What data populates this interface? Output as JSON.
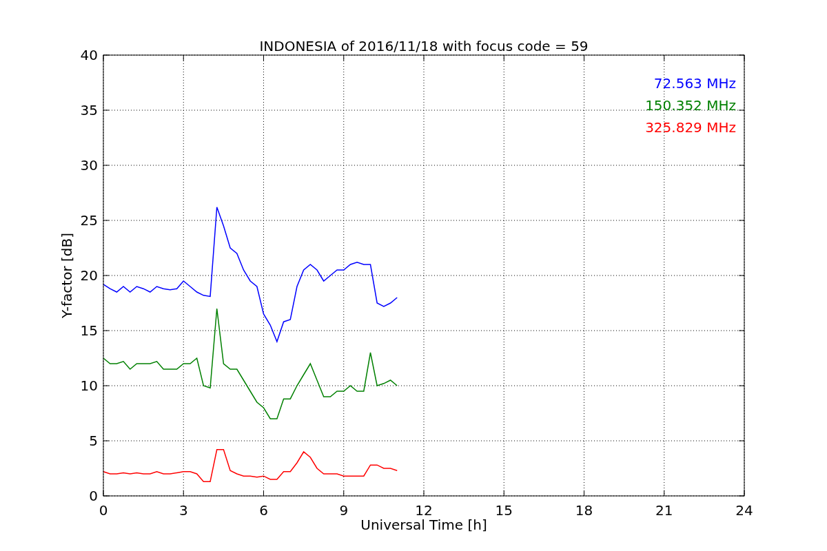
{
  "figure": {
    "chart_data": {
      "type": "line",
      "title": "INDONESIA of 2016/11/18 with focus code = 59",
      "xlabel": "Universal Time [h]",
      "ylabel": "Y-factor [dB]",
      "x": [
        0,
        0.25,
        0.5,
        0.75,
        1,
        1.25,
        1.5,
        1.75,
        2,
        2.25,
        2.5,
        2.75,
        3,
        3.25,
        3.5,
        3.75,
        4,
        4.25,
        4.5,
        4.75,
        5,
        5.25,
        5.5,
        5.75,
        6,
        6.25,
        6.5,
        6.75,
        7,
        7.25,
        7.5,
        7.75,
        8,
        8.25,
        8.5,
        8.75,
        9,
        9.25,
        9.5,
        9.75,
        10,
        10.25,
        10.5,
        10.75,
        11
      ],
      "series": [
        {
          "name": "72.563 MHz",
          "color": "#0000ff",
          "values": [
            19.2,
            18.8,
            18.5,
            19,
            18.5,
            19,
            18.8,
            18.5,
            19,
            18.8,
            18.7,
            18.8,
            19.5,
            19,
            18.5,
            18.2,
            18.1,
            26.2,
            24.5,
            22.5,
            22,
            20.5,
            19.5,
            19,
            16.5,
            15.5,
            14,
            15.8,
            16,
            19,
            20.5,
            21,
            20.5,
            19.5,
            20,
            20.5,
            20.5,
            21,
            21.2,
            21,
            21,
            17.5,
            17.2,
            17.5,
            18
          ]
        },
        {
          "name": "150.352 MHz",
          "color": "#008000",
          "values": [
            12.5,
            12,
            12,
            12.2,
            11.5,
            12,
            12,
            12,
            12.2,
            11.5,
            11.5,
            11.5,
            12,
            12,
            12.5,
            10,
            9.8,
            17,
            12,
            11.5,
            11.5,
            10.5,
            9.5,
            8.5,
            8,
            7,
            7,
            8.8,
            8.8,
            10,
            11,
            12,
            10.5,
            9,
            9,
            9.5,
            9.5,
            10,
            9.5,
            9.5,
            13,
            10,
            10.2,
            10.5,
            10
          ]
        },
        {
          "name": "325.829 MHz",
          "color": "#ff0000",
          "values": [
            2.2,
            2,
            2,
            2.1,
            2,
            2.1,
            2,
            2,
            2.2,
            2,
            2,
            2.1,
            2.2,
            2.2,
            2,
            1.3,
            1.3,
            4.2,
            4.2,
            2.3,
            2,
            1.8,
            1.8,
            1.7,
            1.8,
            1.5,
            1.5,
            2.2,
            2.2,
            3,
            4,
            3.5,
            2.5,
            2,
            2,
            2,
            1.8,
            1.8,
            1.8,
            1.8,
            2.8,
            2.8,
            2.5,
            2.5,
            2.3
          ]
        }
      ],
      "grid": true,
      "xlim": [
        0,
        24
      ],
      "ylim": [
        0,
        40
      ],
      "xticks": [
        0,
        3,
        6,
        9,
        12,
        15,
        18,
        21,
        24
      ],
      "yticks": [
        0,
        5,
        10,
        15,
        20,
        25,
        30,
        35,
        40
      ]
    }
  }
}
